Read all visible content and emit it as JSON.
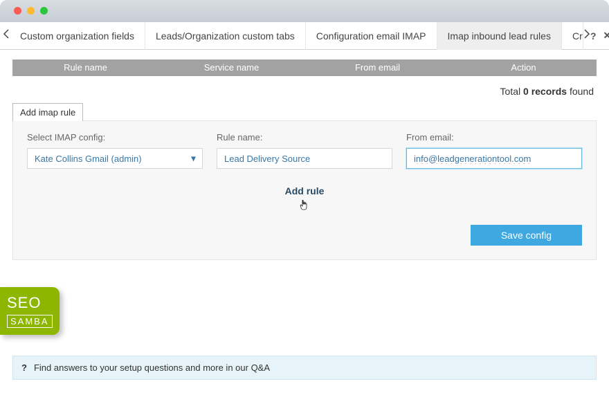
{
  "tabs": {
    "items": [
      "Custom organization fields",
      "Leads/Organization custom tabs",
      "Configuration email IMAP",
      "Imap inbound lead rules",
      "Create new lead"
    ],
    "activeIndex": 3
  },
  "grid": {
    "headers": [
      "Rule name",
      "Service name",
      "From email",
      "Action"
    ]
  },
  "records": {
    "prefix": "Total",
    "count": "0 records",
    "suffix": "found"
  },
  "panel": {
    "tabLabel": "Add imap rule",
    "fields": {
      "config": {
        "label": "Select IMAP config:",
        "value": "Kate Collins Gmail (admin)"
      },
      "ruleName": {
        "label": "Rule name:",
        "value": "Lead Delivery Source"
      },
      "fromEmail": {
        "label": "From email:",
        "value": "info@leadgenerationtool.com"
      }
    },
    "addRule": "Add rule",
    "saveBtn": "Save config"
  },
  "logo": {
    "line1": "SEO",
    "line2": "SAMBA"
  },
  "qa": {
    "icon": "?",
    "text": "Find answers to your setup questions and more in our Q&A"
  }
}
